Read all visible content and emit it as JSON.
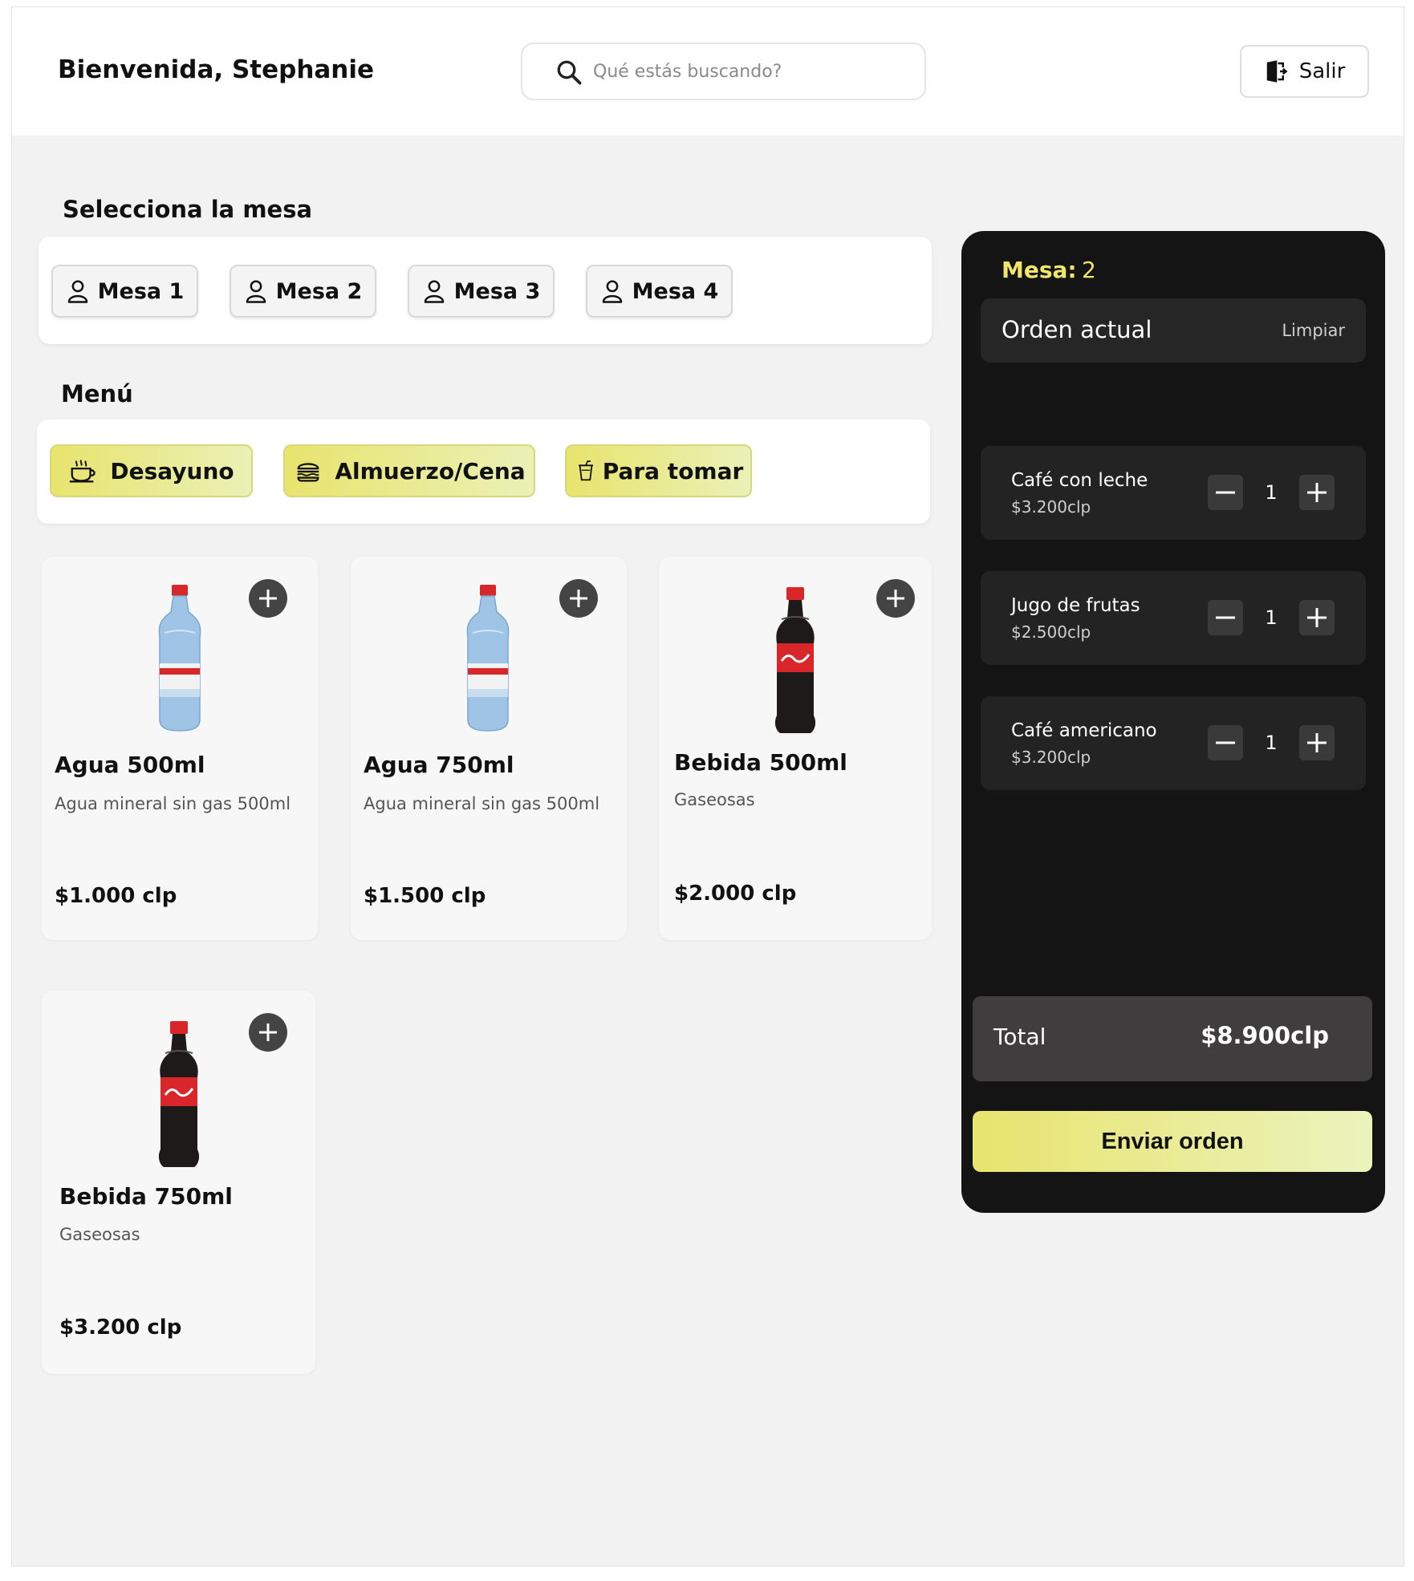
{
  "header": {
    "welcome": "Bienvenida, Stephanie",
    "search_placeholder": "Qué estás buscando?",
    "logout_label": "Salir"
  },
  "tables": {
    "title": "Selecciona la mesa",
    "items": [
      {
        "label": "Mesa 1"
      },
      {
        "label": "Mesa 2"
      },
      {
        "label": "Mesa 3"
      },
      {
        "label": "Mesa 4"
      }
    ]
  },
  "menu": {
    "title": "Menú",
    "categories": [
      {
        "label": "Desayuno",
        "icon": "coffee-cup-icon"
      },
      {
        "label": "Almuerzo/Cena",
        "icon": "burger-icon"
      },
      {
        "label": "Para tomar",
        "icon": "drink-cup-icon"
      }
    ]
  },
  "products": [
    {
      "name": "Agua 500ml",
      "description": "Agua mineral sin gas 500ml",
      "price": "$1.000 clp",
      "image": "water-bottle"
    },
    {
      "name": "Agua 750ml",
      "description": "Agua mineral sin gas 500ml",
      "price": "$1.500 clp",
      "image": "water-bottle"
    },
    {
      "name": "Bebida 500ml",
      "description": "Gaseosas",
      "price": "$2.000 clp",
      "image": "cola-bottle"
    },
    {
      "name": "Bebida 750ml",
      "description": "Gaseosas",
      "price": "$3.200 clp",
      "image": "cola-bottle"
    }
  ],
  "order": {
    "table_label": "Mesa:",
    "table_value": "2",
    "header_title": "Orden actual",
    "clear_label": "Limpiar",
    "items": [
      {
        "name": "Café con leche",
        "price": "$3.200clp",
        "quantity": "1"
      },
      {
        "name": "Jugo de frutas",
        "price": "$2.500clp",
        "quantity": "1"
      },
      {
        "name": "Café americano",
        "price": "$3.200clp",
        "quantity": "1"
      }
    ],
    "total_label": "Total",
    "total_value": "$8.900clp",
    "submit_label": "Enviar orden"
  },
  "colors": {
    "accent_yellow": "#e8e46e",
    "dark_panel": "#141414",
    "background": "#f2f2f2"
  }
}
